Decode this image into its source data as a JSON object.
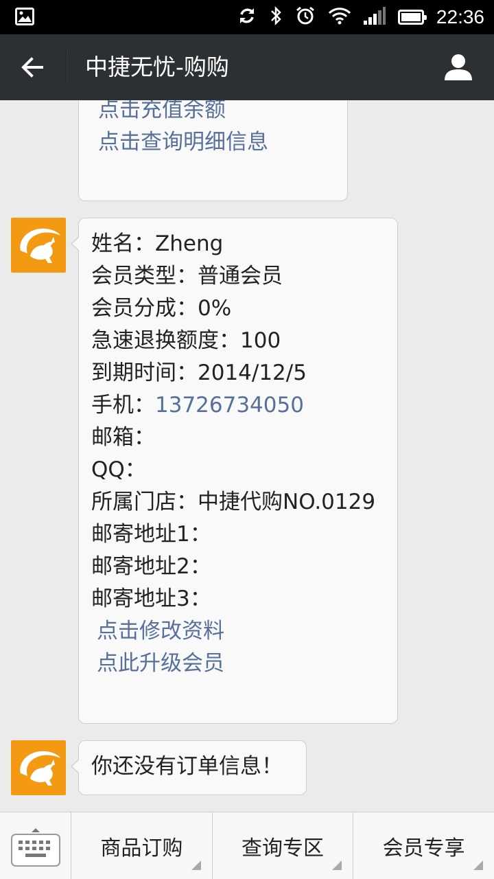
{
  "status_bar": {
    "time": "22:36",
    "battery_level": 0.85,
    "icons": [
      "image-icon",
      "sync-icon",
      "bluetooth-icon",
      "alarm-icon",
      "wifi-icon",
      "signal-icon",
      "battery-icon"
    ]
  },
  "header": {
    "title": "中捷无忧-购购"
  },
  "messages": {
    "m1": {
      "links": [
        "点击充值余额",
        "点击查询明细信息"
      ]
    },
    "m2": {
      "name_line": "姓名：Zheng",
      "type_line": "会员类型：普通会员",
      "share_line": "会员分成：0%",
      "quota_line": "急速退换额度：100",
      "expire_line": "到期时间：2014/12/5",
      "phone_label": "手机：",
      "phone_value": "13726734050",
      "email_line": "邮箱：",
      "qq_line": "QQ：",
      "store_line": "所属门店：中捷代购NO.0129",
      "addr1_line": "邮寄地址1：",
      "addr2_line": "邮寄地址2：",
      "addr3_line": "邮寄地址3：",
      "links": [
        "点击修改资料",
        "点此升级会员"
      ]
    },
    "m3": {
      "text": "你还没有订单信息！"
    }
  },
  "bottom_menu": {
    "items": [
      "商品订购",
      "查询专区",
      "会员专享"
    ]
  },
  "colors": {
    "status_bar": "#000000",
    "title_bar": "#2c3033",
    "background": "#ebebeb",
    "link": "#56709a",
    "avatar": "#f39a12"
  }
}
